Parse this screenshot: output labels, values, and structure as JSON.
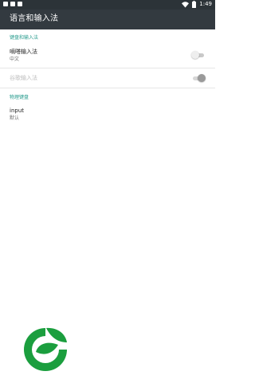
{
  "status_bar": {
    "time": "1:49",
    "icons": [
      "notification-square-icon",
      "notification-square-icon",
      "notification-square-icon",
      "wifi-icon",
      "battery-icon"
    ]
  },
  "app_bar": {
    "title": "语言和输入法"
  },
  "sections": {
    "keyboard": {
      "header": "键盘和输入法",
      "items": [
        {
          "title": "嘀嗒输入法",
          "subtitle": "中文",
          "toggle": "off"
        },
        {
          "title": "谷歌输入法",
          "subtitle": "",
          "toggle": "on",
          "disabled": true
        }
      ]
    },
    "physical": {
      "header": "物理键盘",
      "items": [
        {
          "title": "input",
          "subtitle": "默认"
        }
      ]
    }
  },
  "colors": {
    "status_bar": "#2c3338",
    "app_bar": "#333a40",
    "accent": "#2a9d8f",
    "logo_green": "#1b9e3e"
  },
  "logo": {
    "icon": "leaf-logo-icon"
  }
}
